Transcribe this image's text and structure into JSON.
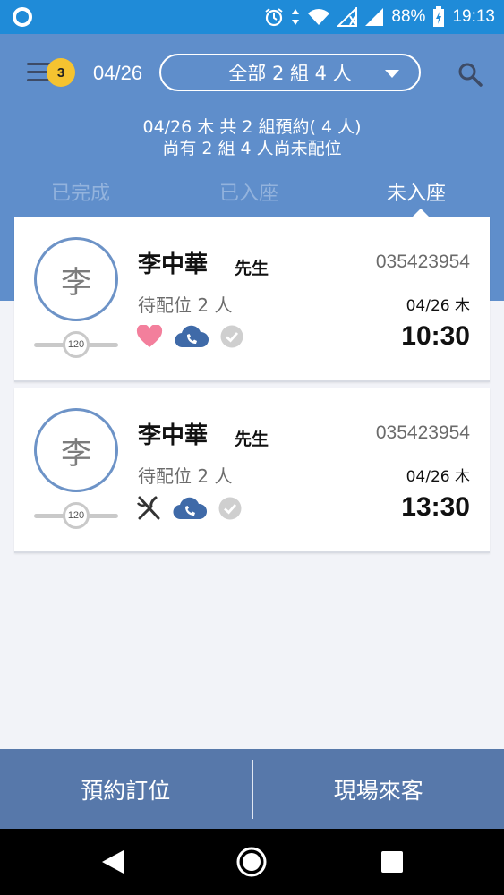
{
  "status_bar": {
    "battery": "88%",
    "time": "19:13",
    "icons": [
      "circle-app-icon",
      "alarm-icon",
      "data-arrows-icon",
      "wifi-icon",
      "signal-icon",
      "signal-icon",
      "battery-charging-icon"
    ]
  },
  "header": {
    "badge_count": "3",
    "date": "04/26",
    "filter_label": "全部 2 組 4 人",
    "summary_line1": "04/26 木 共 2 組預約( 4 人)",
    "summary_line2": "尚有 2 組 4 人尚未配位"
  },
  "tabs": [
    {
      "label": "已完成",
      "active": false
    },
    {
      "label": "已入座",
      "active": false
    },
    {
      "label": "未入座",
      "active": true
    }
  ],
  "reservations": [
    {
      "avatar_char": "李",
      "name": "李中華",
      "title": "先生",
      "phone": "035423954",
      "status": "待配位 2 人",
      "date": "04/26 木",
      "time": "10:30",
      "slider_value": "120",
      "slider_fraction": 0.5,
      "icons": [
        "heart-icon",
        "cloud-phone-icon",
        "check-circle-icon"
      ]
    },
    {
      "avatar_char": "李",
      "name": "李中華",
      "title": "先生",
      "phone": "035423954",
      "status": "待配位 2 人",
      "date": "04/26 木",
      "time": "13:30",
      "slider_value": "120",
      "slider_fraction": 0.5,
      "icons": [
        "utensils-icon",
        "cloud-phone-icon",
        "check-circle-icon"
      ]
    }
  ],
  "bottom_bar": {
    "left_label": "預約訂位",
    "right_label": "現場來客"
  },
  "colors": {
    "status_bar": "#1f8bd8",
    "header": "#5f8ecb",
    "accent_badge": "#f5c330",
    "bottom_bar": "#5778aa",
    "heart": "#f37f9c",
    "cloud": "#3f6aa8"
  }
}
